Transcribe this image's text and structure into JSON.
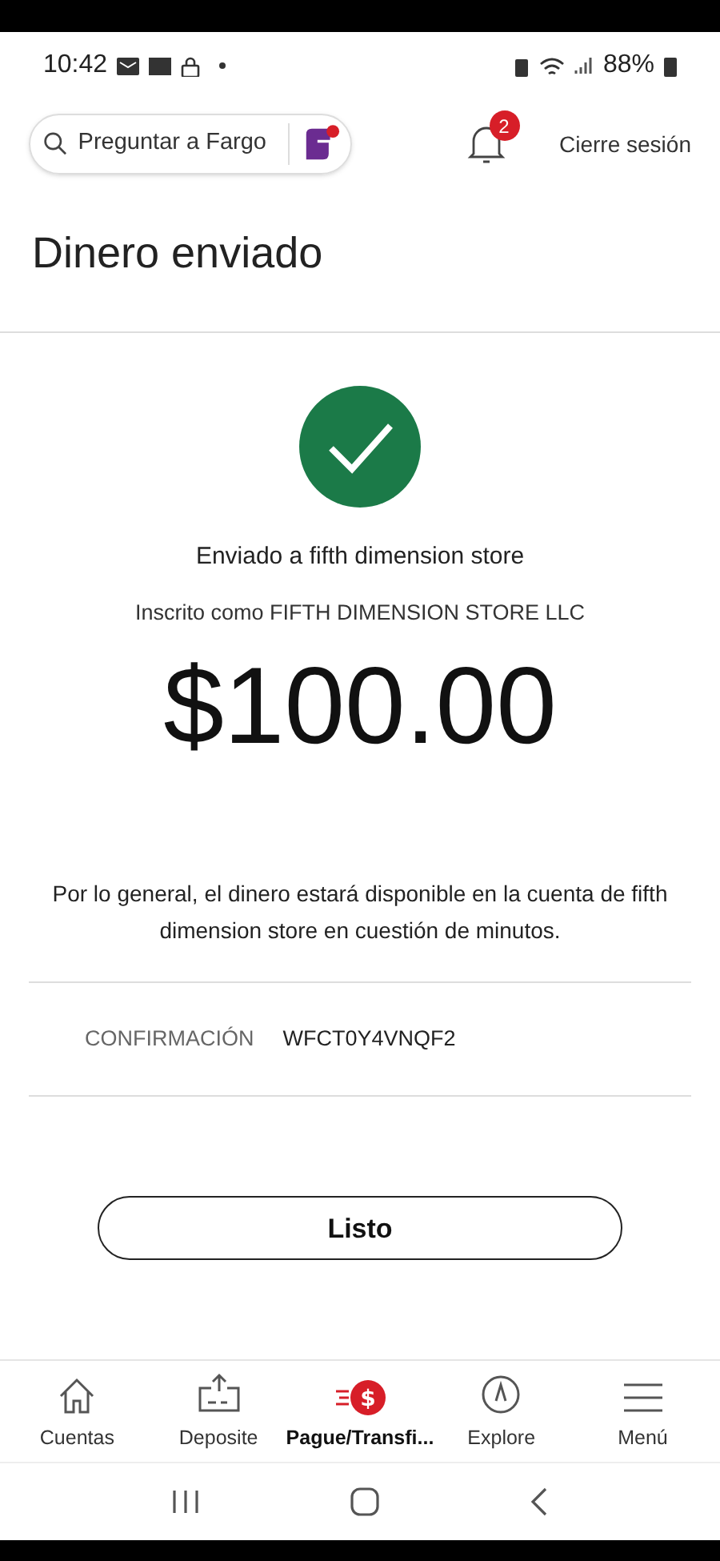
{
  "status_bar": {
    "time": "10:42",
    "battery": "88%"
  },
  "header": {
    "search": {
      "placeholder": "Preguntar a Fargo"
    },
    "notifications": {
      "count": "2"
    },
    "logout": "Cierre sesión"
  },
  "title": "Dinero enviado",
  "confirmation": {
    "sent_to": "Enviado a fifth dimension store",
    "enrolled_as": "Inscrito como FIFTH DIMENSION STORE LLC",
    "amount": "$100.00",
    "note": "Por lo general, el dinero estará disponible en la cuenta de fifth dimension store en cuestión de minutos.",
    "code_label": "CONFIRMACIÓN",
    "code": "WFCT0Y4VNQF2"
  },
  "done_button": "Listo",
  "nav": [
    {
      "kind": "home",
      "label": "Cuentas",
      "selected": false
    },
    {
      "kind": "deposit",
      "label": "Deposite",
      "selected": false
    },
    {
      "kind": "pay",
      "label": "Pague/Transfi...",
      "icon_text": "$",
      "selected": true
    },
    {
      "kind": "explore",
      "label": "Explore",
      "selected": false
    },
    {
      "kind": "menu",
      "label": "Menú",
      "selected": false
    }
  ]
}
